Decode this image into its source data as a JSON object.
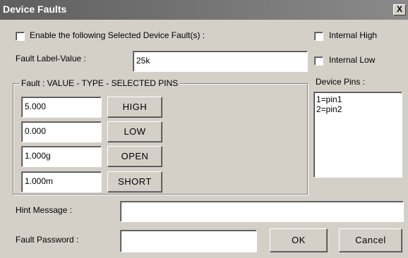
{
  "window": {
    "title": "Device Faults",
    "close_glyph": "X"
  },
  "enable": {
    "label": "Enable the following Selected Device Fault(s) :",
    "checked": false
  },
  "internal_high": {
    "label": "Internal High",
    "checked": false
  },
  "internal_low": {
    "label": "Internal Low",
    "checked": false
  },
  "fault_label": {
    "label": "Fault Label-Value :",
    "value": "25k"
  },
  "device_pins": {
    "label": "Device Pins :",
    "items": [
      "1=pin1",
      "2=pin2"
    ]
  },
  "fault_group": {
    "legend": "Fault : VALUE  -  TYPE  -  SELECTED PINS",
    "rows": [
      {
        "value": "5.000",
        "type": "HIGH"
      },
      {
        "value": "0.000",
        "type": "LOW"
      },
      {
        "value": "1.000g",
        "type": "OPEN"
      },
      {
        "value": "1.000m",
        "type": "SHORT"
      }
    ]
  },
  "hint": {
    "label": "Hint Message :",
    "value": ""
  },
  "password": {
    "label": "Fault Password :",
    "value": ""
  },
  "buttons": {
    "ok": "OK",
    "cancel": "Cancel"
  }
}
